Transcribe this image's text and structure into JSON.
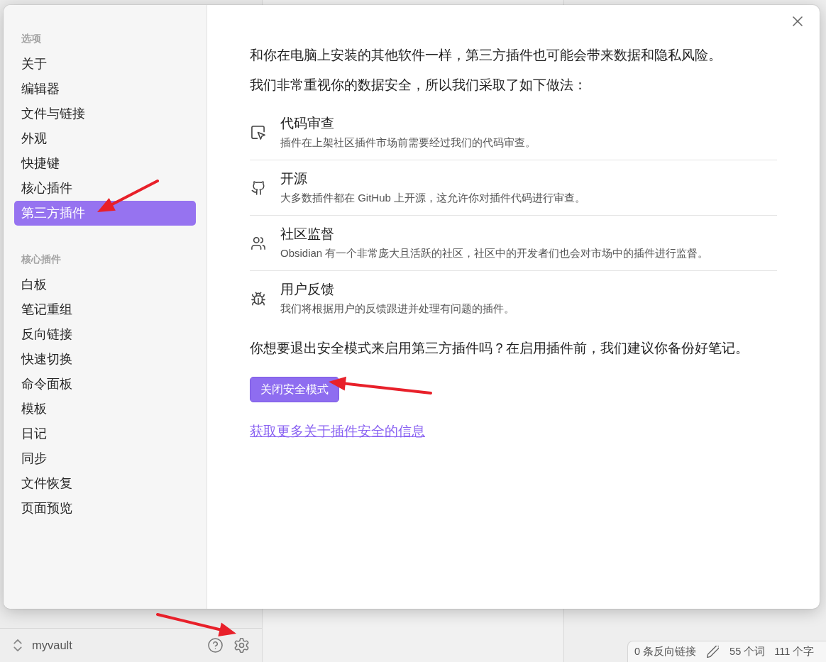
{
  "sidebar": {
    "sections": [
      {
        "heading": "选项",
        "items": [
          {
            "label": "关于",
            "selected": false
          },
          {
            "label": "编辑器",
            "selected": false
          },
          {
            "label": "文件与链接",
            "selected": false
          },
          {
            "label": "外观",
            "selected": false
          },
          {
            "label": "快捷键",
            "selected": false
          },
          {
            "label": "核心插件",
            "selected": false
          },
          {
            "label": "第三方插件",
            "selected": true
          }
        ]
      },
      {
        "heading": "核心插件",
        "items": [
          {
            "label": "白板",
            "selected": false
          },
          {
            "label": "笔记重组",
            "selected": false
          },
          {
            "label": "反向链接",
            "selected": false
          },
          {
            "label": "快速切换",
            "selected": false
          },
          {
            "label": "命令面板",
            "selected": false
          },
          {
            "label": "模板",
            "selected": false
          },
          {
            "label": "日记",
            "selected": false
          },
          {
            "label": "同步",
            "selected": false
          },
          {
            "label": "文件恢复",
            "selected": false
          },
          {
            "label": "页面预览",
            "selected": false
          }
        ]
      }
    ]
  },
  "content": {
    "paragraphs": [
      "和你在电脑上安装的其他软件一样，第三方插件也可能会带来数据和隐私风险。",
      "我们非常重视你的数据安全，所以我们采取了如下做法："
    ],
    "measures": [
      {
        "kind": "cursor",
        "title": "代码审查",
        "description": "插件在上架社区插件市场前需要经过我们的代码审查。"
      },
      {
        "kind": "github",
        "title": "开源",
        "description": "大多数插件都在 GitHub 上开源，这允许你对插件代码进行审查。"
      },
      {
        "kind": "users",
        "title": "社区监督",
        "description": "Obsidian 有一个非常庞大且活跃的社区，社区中的开发者们也会对市场中的插件进行监督。"
      },
      {
        "kind": "bug",
        "title": "用户反馈",
        "description": "我们将根据用户的反馈跟进并处理有问题的插件。"
      }
    ],
    "question": "你想要退出安全模式来启用第三方插件吗？在启用插件前，我们建议你备份好笔记。",
    "button": "关闭安全模式",
    "link": "获取更多关于插件安全的信息"
  },
  "vault": {
    "name": "myvault"
  },
  "status_bar": {
    "items": [
      "0 条反向链接",
      "55 个词",
      "111 个字"
    ]
  },
  "annotations": [
    {
      "kind": "arrow"
    },
    {
      "kind": "arrow"
    },
    {
      "kind": "arrow"
    }
  ]
}
